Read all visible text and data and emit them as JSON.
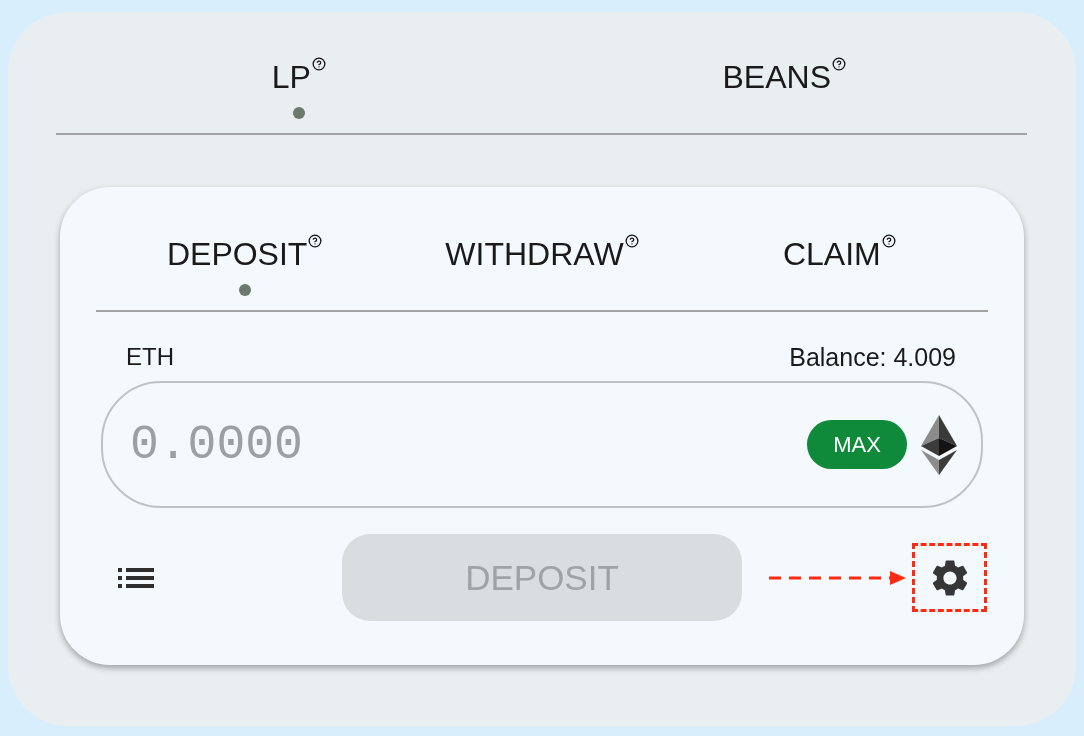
{
  "asset_tabs": [
    {
      "label": "LP",
      "selected": true
    },
    {
      "label": "BEANS",
      "selected": false
    }
  ],
  "action_tabs": [
    {
      "label": "DEPOSIT",
      "selected": true
    },
    {
      "label": "WITHDRAW",
      "selected": false
    },
    {
      "label": "CLAIM",
      "selected": false
    }
  ],
  "token": {
    "symbol": "ETH",
    "balance": "Balance: 4.009"
  },
  "amount_field": {
    "placeholder": "0.0000"
  },
  "max_button": "MAX",
  "submit_button": {
    "label": "DEPOSIT",
    "disabled": true
  },
  "settings": {
    "highlighted": true
  }
}
